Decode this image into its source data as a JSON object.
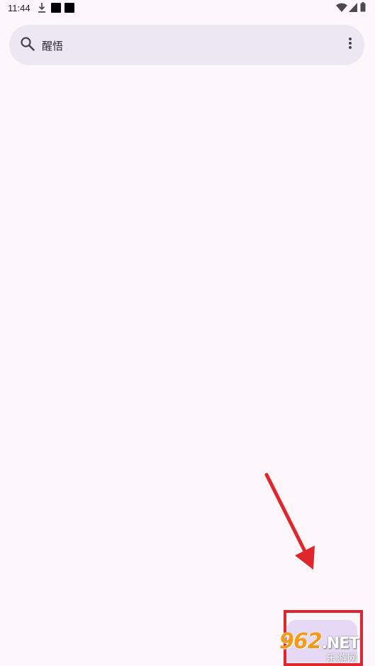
{
  "status_bar": {
    "time": "11:44",
    "icons": [
      "download-icon",
      "notification-icon",
      "notification-icon",
      "wifi-icon",
      "signal-icon",
      "battery-icon"
    ]
  },
  "search": {
    "query": "醒悟",
    "icon": "search-icon",
    "menu_icon": "more-vert-icon"
  },
  "watermark": {
    "number": "962",
    "suffix": ".NET",
    "subtitle": "乐游网"
  },
  "colors": {
    "background": "#fdf7fc",
    "search_bar": "#ece7f1",
    "annotation": "#e0262d",
    "fab": "#e5d9f6"
  }
}
